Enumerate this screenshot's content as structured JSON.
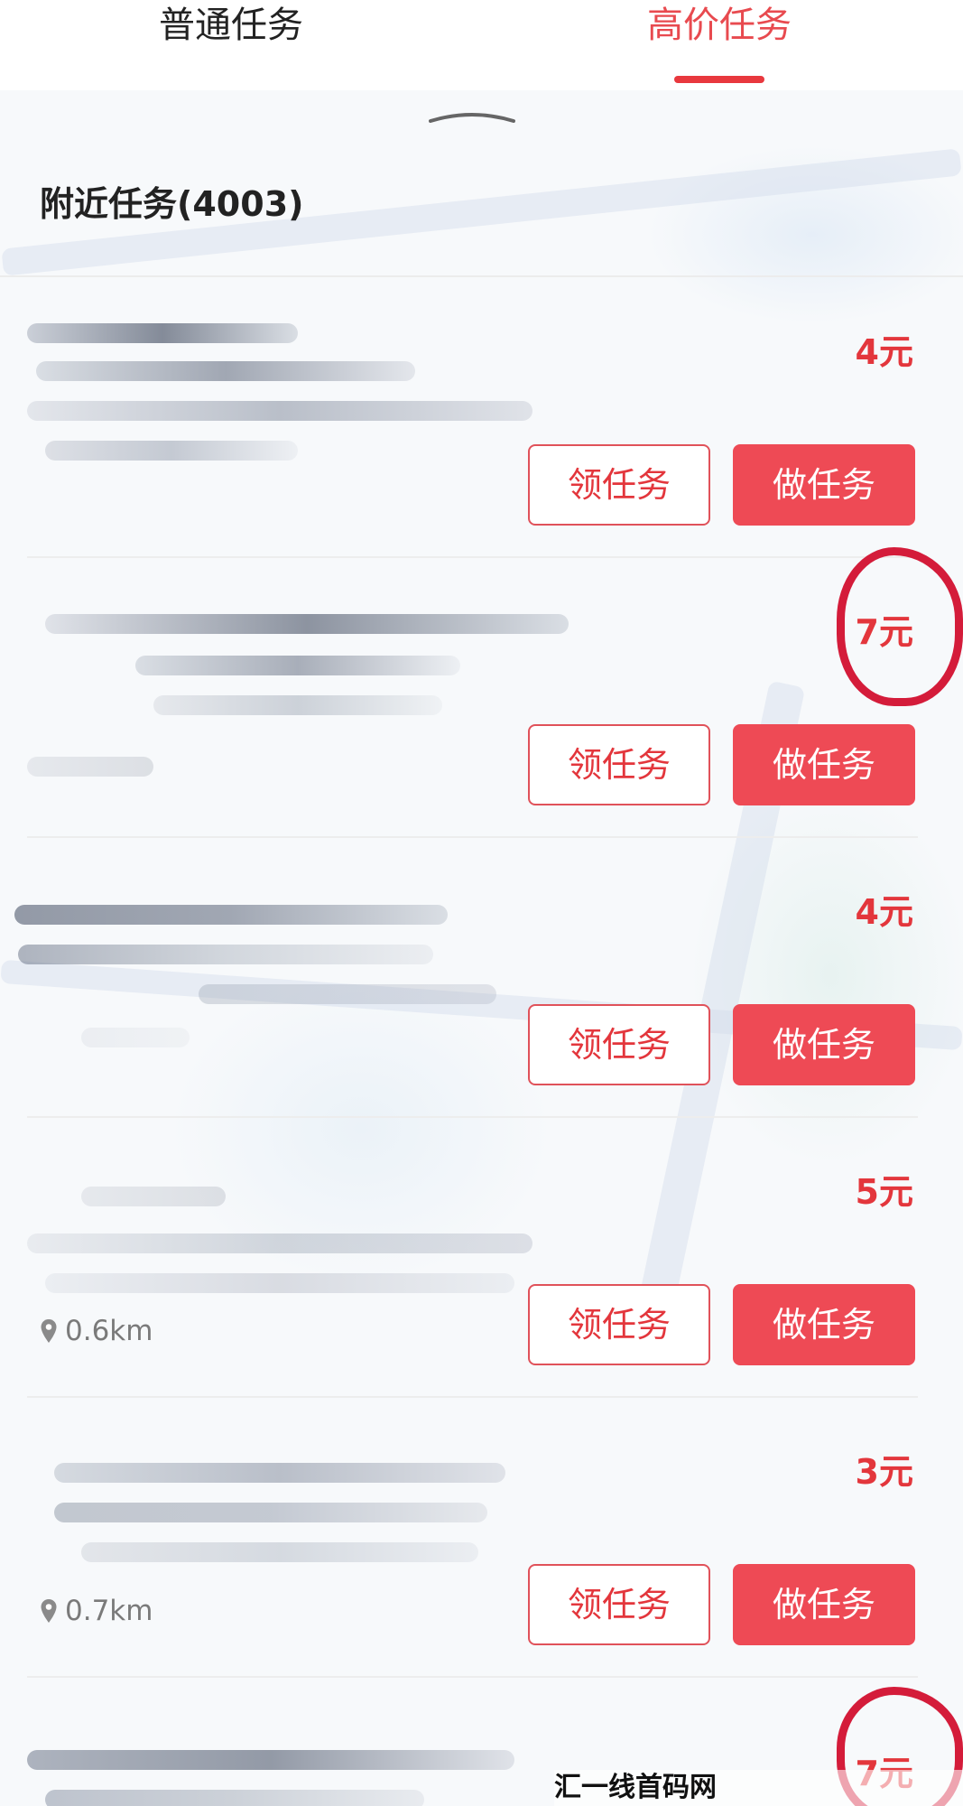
{
  "tabs": [
    {
      "label": "普通任务",
      "active": false
    },
    {
      "label": "高价任务",
      "active": true
    }
  ],
  "section": {
    "title": "附近任务(4003)"
  },
  "tasks": [
    {
      "price": "4元",
      "distance": "",
      "claim_label": "领任务",
      "do_label": "做任务",
      "circled": false
    },
    {
      "price": "7元",
      "distance": "",
      "claim_label": "领任务",
      "do_label": "做任务",
      "circled": true
    },
    {
      "price": "4元",
      "distance": "",
      "claim_label": "领任务",
      "do_label": "做任务",
      "circled": false
    },
    {
      "price": "5元",
      "distance": "0.6km",
      "claim_label": "领任务",
      "do_label": "做任务",
      "circled": false
    },
    {
      "price": "3元",
      "distance": "0.7km",
      "claim_label": "领任务",
      "do_label": "做任务",
      "circled": false
    },
    {
      "price": "7元",
      "distance": "",
      "circled": true
    }
  ],
  "watermark": "汇一线首码网 www.huiyixian.com",
  "colors": {
    "accent": "#e3363c",
    "button_fill": "#ee4a55",
    "annotation": "#d41c3a"
  },
  "icons": {
    "location": "location-pin-icon",
    "handle": "chevron-up-handle-icon"
  }
}
